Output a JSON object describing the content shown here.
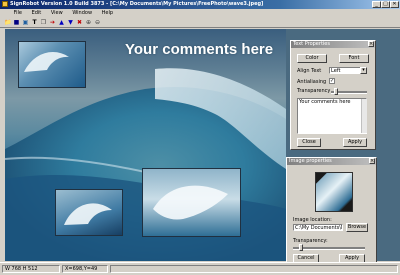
{
  "window": {
    "title": "SignRobot Version 1.0 Build 3873 - [C:\\My Documents\\My Pictures\\FreePhoto\\wave3.jpeg]",
    "controls": [
      "_",
      "□",
      "✕"
    ]
  },
  "menu": {
    "items": [
      "File",
      "Edit",
      "View",
      "Window",
      "Help"
    ]
  },
  "toolbar": {
    "buttons": [
      {
        "icon": "open-folder-icon",
        "glyph": "📁"
      },
      {
        "icon": "save-icon",
        "glyph": "■"
      },
      {
        "icon": "image-icon",
        "glyph": "▣"
      },
      {
        "icon": "text-icon",
        "glyph": "T"
      },
      {
        "icon": "copy-icon",
        "glyph": "❐"
      },
      {
        "icon": "arrow-right-icon",
        "glyph": "➔"
      },
      {
        "icon": "arrow-up-icon",
        "glyph": "▲"
      },
      {
        "icon": "arrow-down-icon",
        "glyph": "▼"
      },
      {
        "icon": "delete-icon",
        "glyph": "✖"
      },
      {
        "icon": "zoom-in-icon",
        "glyph": "⊕"
      },
      {
        "icon": "zoom-out-icon",
        "glyph": "⊖"
      }
    ]
  },
  "canvas": {
    "overlay_text": "Your comments here"
  },
  "text_properties": {
    "title": "Text Properties",
    "color_button": "Color",
    "font_button": "Font",
    "align_label": "Align Text",
    "align_value": "Left",
    "antialiasing_label": "Antialiasing",
    "antialiasing_checked": true,
    "transparency_label": "Transparency",
    "transparency_value": 0.1,
    "text_value": "Your comments here",
    "close_button": "Close",
    "apply_button": "Apply"
  },
  "image_properties": {
    "title": "Image properties",
    "location_label": "Image location:",
    "location_value": "C:\\My Documents\\My",
    "browse_button": "Browse",
    "transparency_label": "Transparency:",
    "transparency_value": 0.1,
    "cancel_button": "Cancel",
    "apply_button": "Apply"
  },
  "status": {
    "size": "W 768 H 512",
    "position": "X=698,Y=49"
  }
}
